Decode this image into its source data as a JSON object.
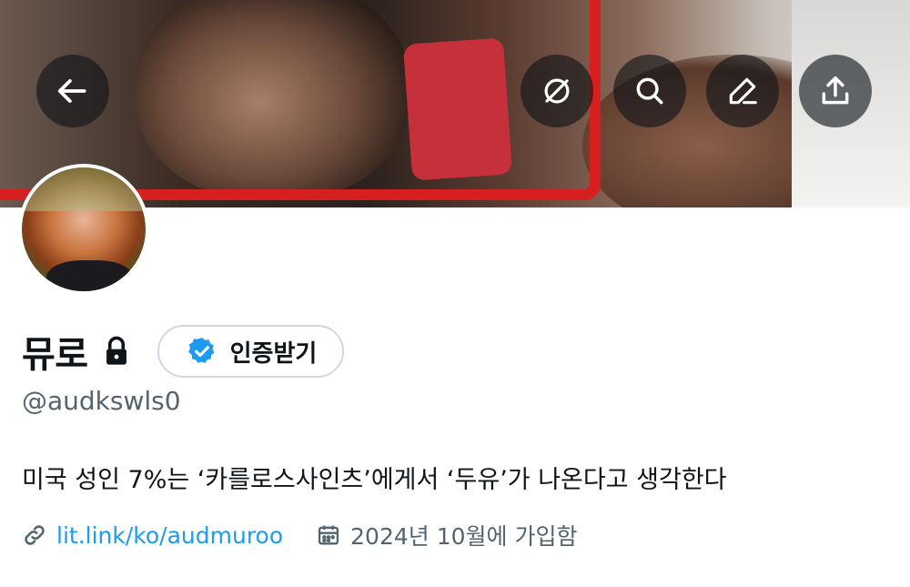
{
  "profile": {
    "display_name": "뮤로",
    "verify_label": "인증받기",
    "handle": "@audkswls0",
    "bio": "미국 성인 7%는 ‘카를로스사인츠’에게서 ‘두유’가 나온다고 생각한다",
    "link": "lit.link/ko/audmuroo",
    "joined": "2024년 10월에 가입함"
  },
  "header": {
    "icons": [
      "back-arrow-icon",
      "grok-icon",
      "search-icon",
      "edit-icon",
      "share-icon"
    ]
  },
  "colors": {
    "link": "#1d9bf0",
    "verified_badge": "#1d9bf0",
    "secondary_text": "#536471",
    "button_border": "#cfd9de"
  }
}
